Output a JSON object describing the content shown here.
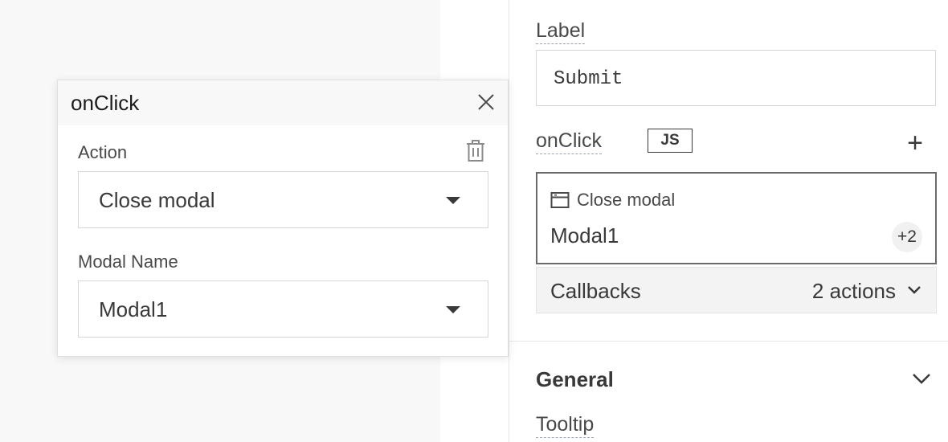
{
  "panel": {
    "label_title": "Label",
    "label_value": "Submit",
    "onclick_title": "onClick",
    "js_toggle": "JS",
    "add_icon": "+",
    "action_card": {
      "action_type": "Close modal",
      "modal_name": "Modal1",
      "extra_badge": "+2"
    },
    "callbacks": {
      "title": "Callbacks",
      "count": "2 actions"
    },
    "general_section": "General",
    "tooltip_title": "Tooltip"
  },
  "popup": {
    "title": "onClick",
    "action_label": "Action",
    "action_value": "Close modal",
    "modal_name_label": "Modal Name",
    "modal_name_value": "Modal1"
  }
}
